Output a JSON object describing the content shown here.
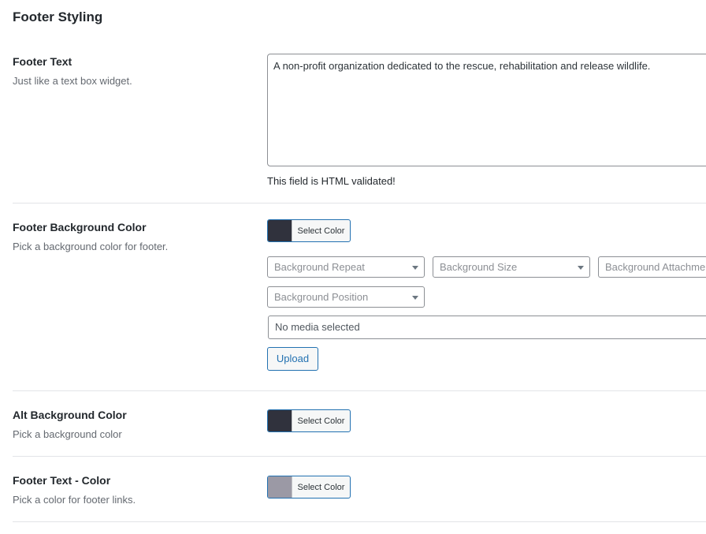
{
  "section": {
    "title": "Footer Styling"
  },
  "footer_text": {
    "label": "Footer Text",
    "description": "Just like a text box widget.",
    "value": "A non-profit organization dedicated to the rescue, rehabilitation and release wildlife.",
    "helper": "This field is HTML validated!"
  },
  "footer_bg": {
    "label": "Footer Background Color",
    "description": "Pick a background color for footer.",
    "color_button": "Select Color",
    "swatch_color": "#30323d",
    "selects": {
      "repeat": "Background Repeat",
      "size": "Background Size",
      "attachment": "Background Attachment",
      "position": "Background Position"
    },
    "media_placeholder": "No media selected",
    "upload_label": "Upload"
  },
  "alt_bg": {
    "label": "Alt Background Color",
    "description": "Pick a background color",
    "color_button": "Select Color",
    "swatch_color": "#30323d"
  },
  "footer_text_color": {
    "label": "Footer Text - Color",
    "description": "Pick a color for footer links.",
    "color_button": "Select Color",
    "swatch_color": "#9b99a5"
  }
}
